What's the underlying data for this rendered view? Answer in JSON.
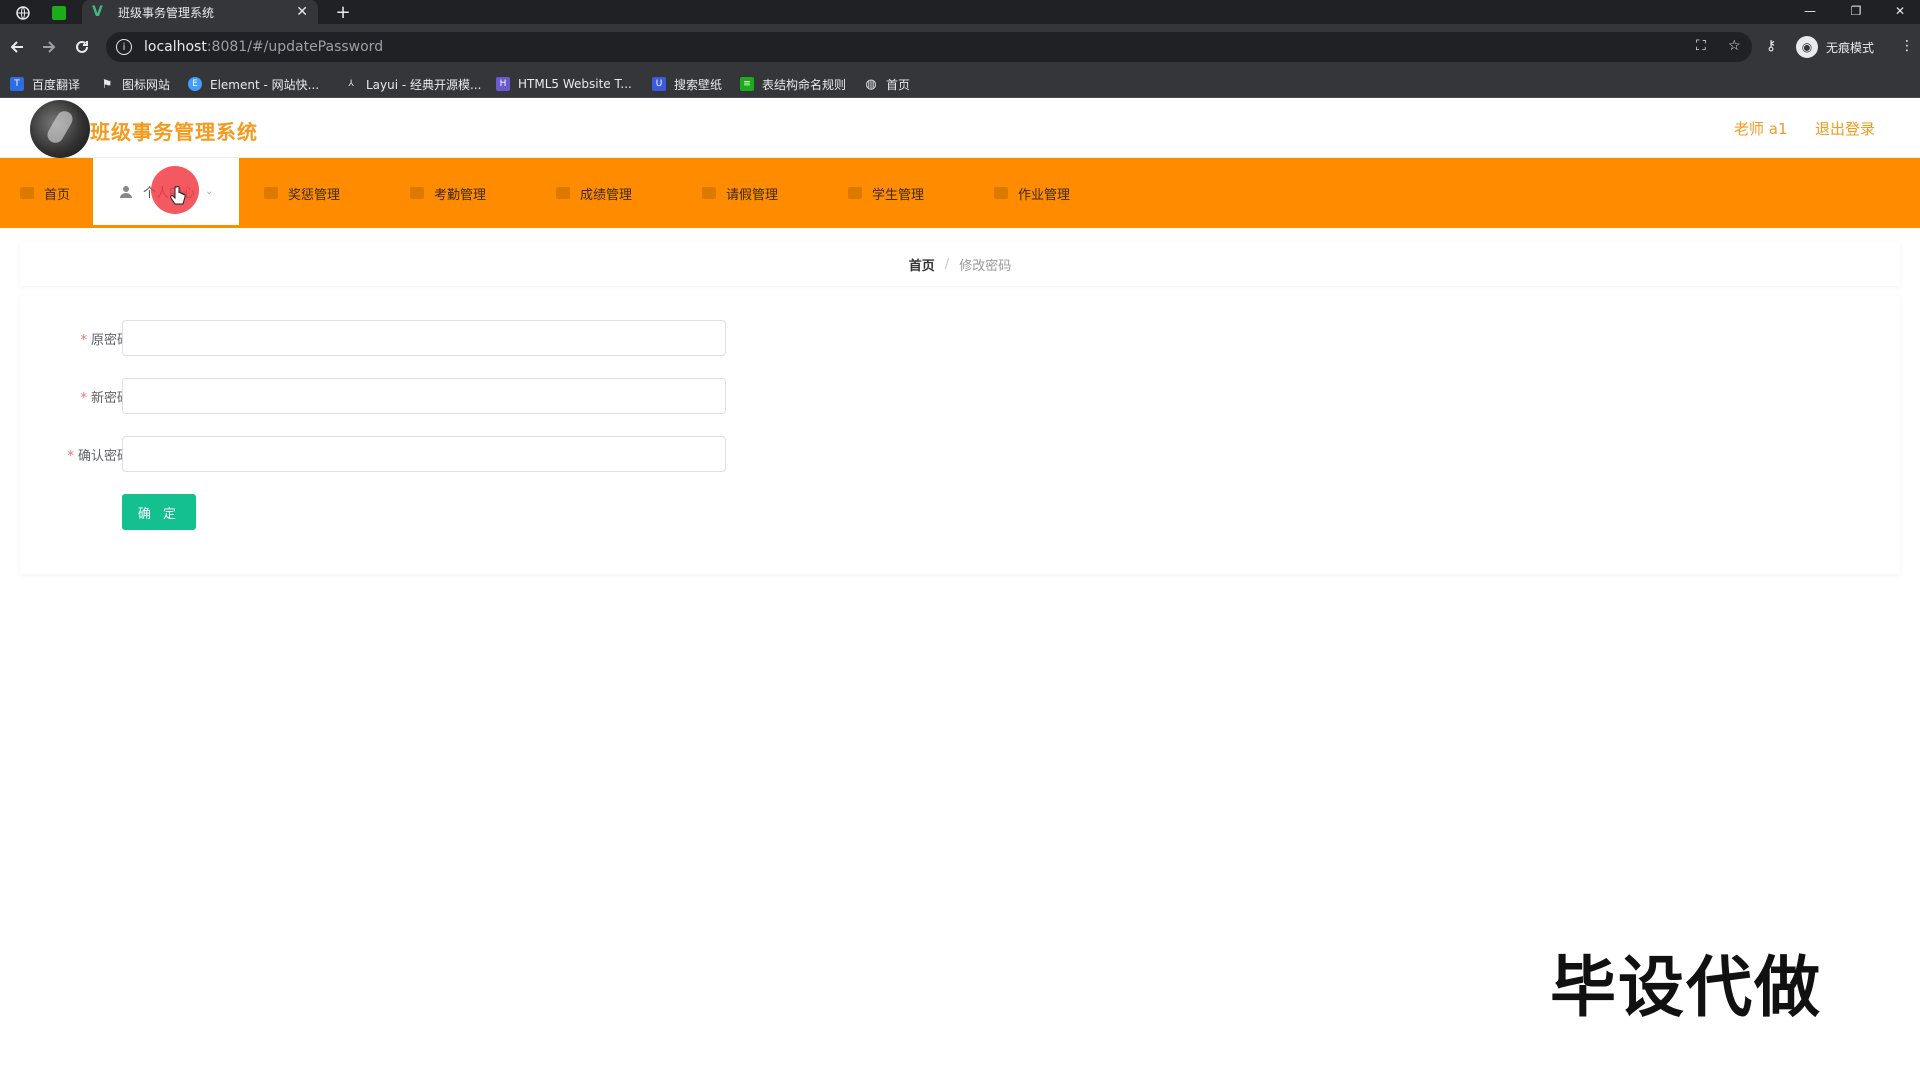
{
  "browser": {
    "tab_title": "班级事务管理系统",
    "url_host": "localhost",
    "url_rest": ":8081/#/updatePassword",
    "profile_label": "无痕模式",
    "bookmarks": [
      {
        "label": "百度翻译",
        "color": "#2b6de5",
        "icon": "translate-icon"
      },
      {
        "label": "图标网站",
        "color": "#555555",
        "icon": "flag-icon"
      },
      {
        "label": "Element - 网站快...",
        "color": "#409eff",
        "icon": "element-icon"
      },
      {
        "label": "Layui - 经典开源模...",
        "color": "#555555",
        "icon": "layui-icon"
      },
      {
        "label": "HTML5 Website T...",
        "color": "#6a5acd",
        "icon": "html5-icon"
      },
      {
        "label": "搜索壁纸",
        "color": "#3b5bdb",
        "icon": "wallpaper-icon"
      },
      {
        "label": "表结构命名规则",
        "color": "#1aad19",
        "icon": "sheet-icon"
      },
      {
        "label": "首页",
        "color": "#555555",
        "icon": "globe-icon"
      }
    ]
  },
  "header": {
    "app_title": "班级事务管理系统",
    "user": "老师 a1",
    "logout": "退出登录"
  },
  "menu": {
    "items": [
      {
        "label": "首页",
        "icon": "home-icon"
      },
      {
        "label": "个人中心",
        "icon": "user-icon"
      },
      {
        "label": "奖惩管理",
        "icon": "award-icon"
      },
      {
        "label": "考勤管理",
        "icon": "attendance-icon"
      },
      {
        "label": "成绩管理",
        "icon": "grade-icon"
      },
      {
        "label": "请假管理",
        "icon": "leave-icon"
      },
      {
        "label": "学生管理",
        "icon": "student-icon"
      },
      {
        "label": "作业管理",
        "icon": "homework-icon"
      }
    ],
    "active_index": 1,
    "bar_color": "#ff8c00"
  },
  "breadcrumb": {
    "home": "首页",
    "separator": "/",
    "current": "修改密码"
  },
  "form": {
    "old_password_label": "原密码",
    "new_password_label": "新密码",
    "confirm_password_label": "确认密码",
    "required_mark": "*",
    "old_password_value": "",
    "new_password_value": "",
    "confirm_password_value": "",
    "submit_label": "确 定",
    "submit_color": "#13c08e"
  },
  "watermark": "毕设代做"
}
